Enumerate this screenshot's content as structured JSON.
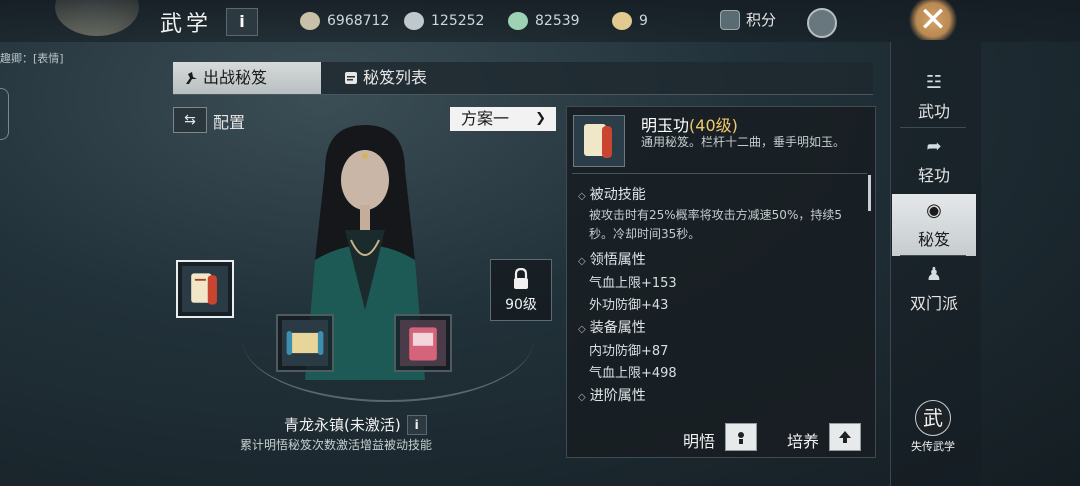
{
  "header": {
    "title": "武学",
    "info_label": "i",
    "resources": [
      {
        "icon": "coin-stack-icon",
        "value": "6968712",
        "color": "#c8c0a8"
      },
      {
        "icon": "silver-ingot-icon",
        "value": "125252",
        "color": "#bfc8cc"
      },
      {
        "icon": "jade-ticket-icon",
        "value": "82539",
        "color": "#9ed2b4"
      },
      {
        "icon": "gold-ingot-add-icon",
        "value": "9",
        "color": "#e1c98f"
      }
    ],
    "points_label": "积分",
    "close_label": "✕"
  },
  "chat_snippet": "趣卿：[表情]",
  "tabs": [
    {
      "label": "出战秘笈",
      "active": true
    },
    {
      "label": "秘笈列表",
      "active": false
    }
  ],
  "config": {
    "label": "配置",
    "plan": "方案一"
  },
  "slots": [
    {
      "icon": "red-scroll-book-icon",
      "selected": true
    },
    {
      "icon": "blue-scroll-icon",
      "selected": false
    },
    {
      "icon": "pink-book-icon",
      "selected": false
    }
  ],
  "locked_slot": {
    "level": "90级"
  },
  "set_bonus": {
    "name": "青龙永镇(未激活)",
    "info_label": "i",
    "desc": "累计明悟秘笈次数激活增益被动技能"
  },
  "detail": {
    "name": "明玉功",
    "level": "(40级)",
    "subtitle": "通用秘笈。栏杆十二曲，垂手明如玉。",
    "passive_title": "被动技能",
    "passive_text": "被攻击时有25%概率将攻击方减速50%，持续5秒。冷却时间35秒。",
    "insight_title": "领悟属性",
    "insight_stats": [
      "气血上限+153",
      "外功防御+43"
    ],
    "equip_title": "装备属性",
    "equip_stats": [
      "内功防御+87",
      "气血上限+498"
    ],
    "advance_title": "进阶属性",
    "insight_btn": "明悟",
    "train_btn": "培养"
  },
  "nav": [
    {
      "label": "武功",
      "icon": "martial-pose-icon",
      "selected": false
    },
    {
      "label": "轻功",
      "icon": "leap-icon",
      "selected": false
    },
    {
      "label": "秘笈",
      "icon": "meditate-icon",
      "selected": true
    },
    {
      "label": "双门派",
      "icon": "dual-sect-icon",
      "selected": false
    }
  ],
  "lost_arts": {
    "label": "失传武学",
    "glyph": "武"
  }
}
